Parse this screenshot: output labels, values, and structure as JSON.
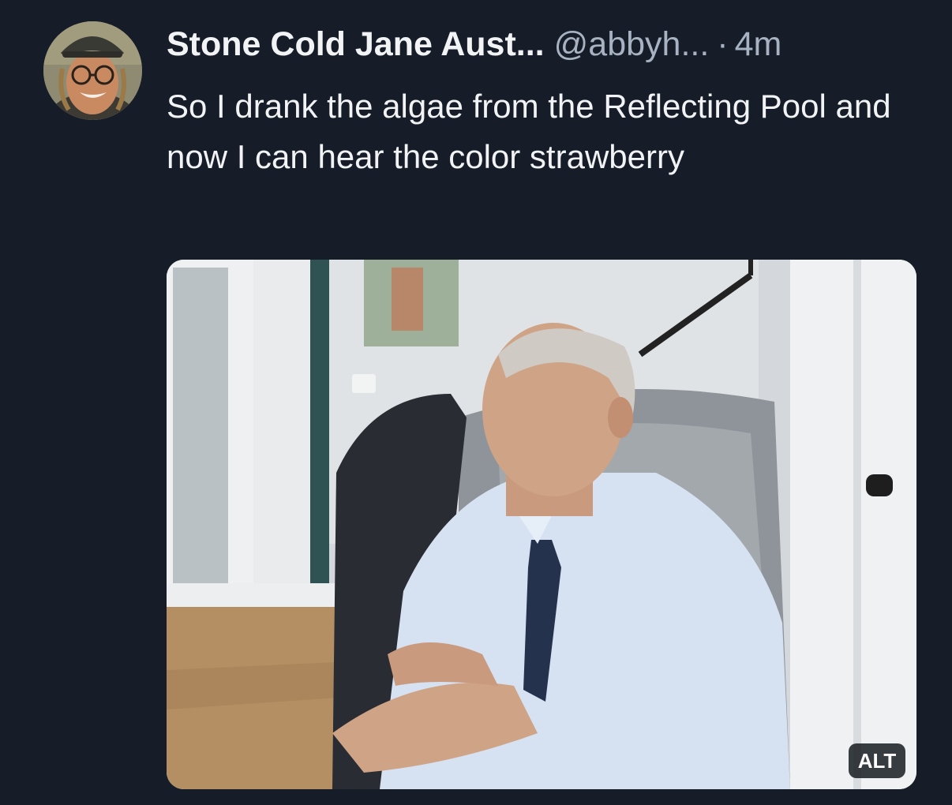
{
  "post": {
    "author": {
      "display_name": "Stone Cold Jane Aust...",
      "handle": "@abbyh...",
      "avatar_icon": "user-avatar-photo"
    },
    "separator": "·",
    "timestamp": "4m",
    "text": "So I drank the algae from the Reflecting Pool and now I can hear the color strawberry",
    "media": {
      "kind": "image",
      "alt_badge_label": "ALT"
    }
  },
  "colors": {
    "background": "#171d28",
    "primary_text": "#f1f3f5",
    "secondary_text": "#a7b3c2",
    "alt_badge_bg": "#1e2228"
  }
}
